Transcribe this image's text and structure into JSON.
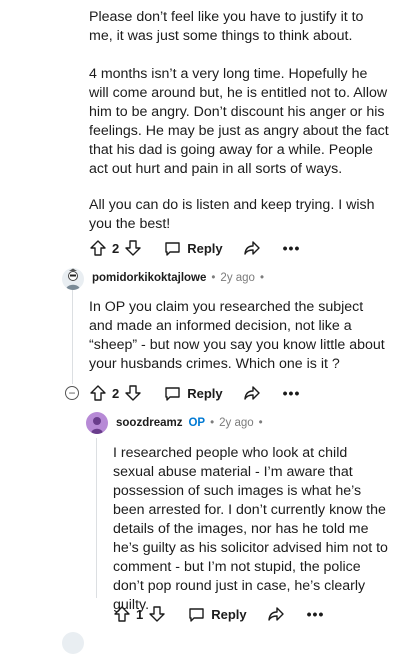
{
  "comments": [
    {
      "paragraphs": [
        "Please don’t feel like you have to justify it to me, it was just some things to think about.",
        "4 months isn’t a very long time. Hopefully he will come around but, he is entitled not to. Allow him to be angry. Don’t discount his anger or his feelings. He may be just as angry about the fact that his dad is going away for a while. People act out hurt and pain in all sorts of ways.",
        "All you can do is listen and keep trying. I wish you the best!"
      ],
      "votes": "2",
      "reply_label": "Reply"
    },
    {
      "username": "pomidorkikoktajlowe",
      "age": "2y ago",
      "paragraphs": [
        "In OP you claim you researched the subject and made an informed decision, not like a “sheep” - but now you say you know little about your husbands crimes. Which one is it ?"
      ],
      "votes": "2",
      "reply_label": "Reply",
      "collapse_symbol": "−"
    },
    {
      "username": "soozdreamz",
      "op_badge": "OP",
      "age": "2y ago",
      "paragraphs": [
        "I researched people who look at child sexual abuse material - I’m aware that possession of such images is what he’s been arrested for. I don’t currently know the details of the images, nor has he told me he’s guilty as his solicitor advised him not to comment - but I’m not stupid, the police don’t pop round just in case, he’s clearly guilty."
      ],
      "votes": "1",
      "reply_label": "Reply"
    }
  ],
  "meta_separator": "•",
  "more_label": "•••",
  "icons": [
    "upvote-icon",
    "downvote-icon",
    "comment-icon",
    "share-icon",
    "more-icon",
    "collapse-icon"
  ],
  "colors": {
    "op_badge": "#0079d3",
    "meta_text": "#7c7c7c",
    "thread_line": "#dcdfe2",
    "avatar_purple": "#b78ad6"
  }
}
